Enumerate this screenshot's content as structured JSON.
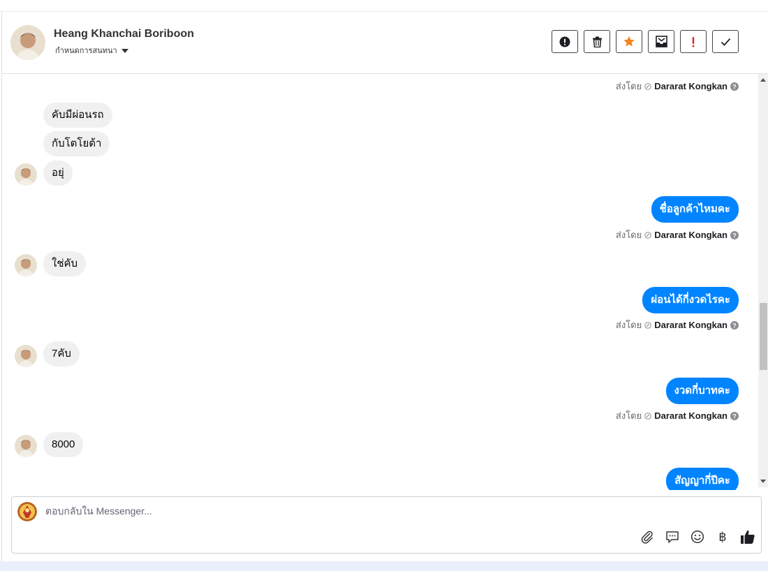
{
  "header": {
    "contact_name": "Heang Khanchai Boriboon",
    "subtitle": "กำหนดการสนทนา",
    "actions": [
      {
        "icon": "alert-circle-icon",
        "name": "spam-button"
      },
      {
        "icon": "trash-icon",
        "name": "delete-button"
      },
      {
        "icon": "star-icon",
        "name": "star-button",
        "color": "#f5831f"
      },
      {
        "icon": "mark-unread-icon",
        "name": "mark-unread-button"
      },
      {
        "icon": "exclamation-icon",
        "name": "important-button",
        "color": "#e02020"
      },
      {
        "icon": "check-icon",
        "name": "done-button"
      }
    ]
  },
  "messages": {
    "sent_by_prefix": "ส่งโดย",
    "agent_name": "Dararat Kongkan",
    "incoming_1": "คับมีผ่อนรถ",
    "incoming_2": "กับโตโยต้า",
    "incoming_3": "อยุ่",
    "outgoing_1": "ชื่อลูกค้าไหมคะ",
    "incoming_4": "ใช่คับ",
    "outgoing_2": "ผ่อนได้กี่งวดไรคะ",
    "incoming_5": "7คับ",
    "outgoing_3": "งวดกี่บาทคะ",
    "incoming_6": "8000",
    "outgoing_4": "สัญญากี่ปีคะ"
  },
  "composer": {
    "placeholder": "ตอบกลับใน Messenger...",
    "value": "",
    "tools": [
      "paperclip-icon",
      "chat-bubble-icon",
      "emoji-icon",
      "baht-icon",
      "thumbs-up-icon"
    ],
    "baht_symbol": "฿"
  },
  "colors": {
    "outgoing_bubble": "#0084ff",
    "incoming_bubble": "#f0f0f0",
    "star": "#f5831f",
    "important": "#e02020"
  }
}
